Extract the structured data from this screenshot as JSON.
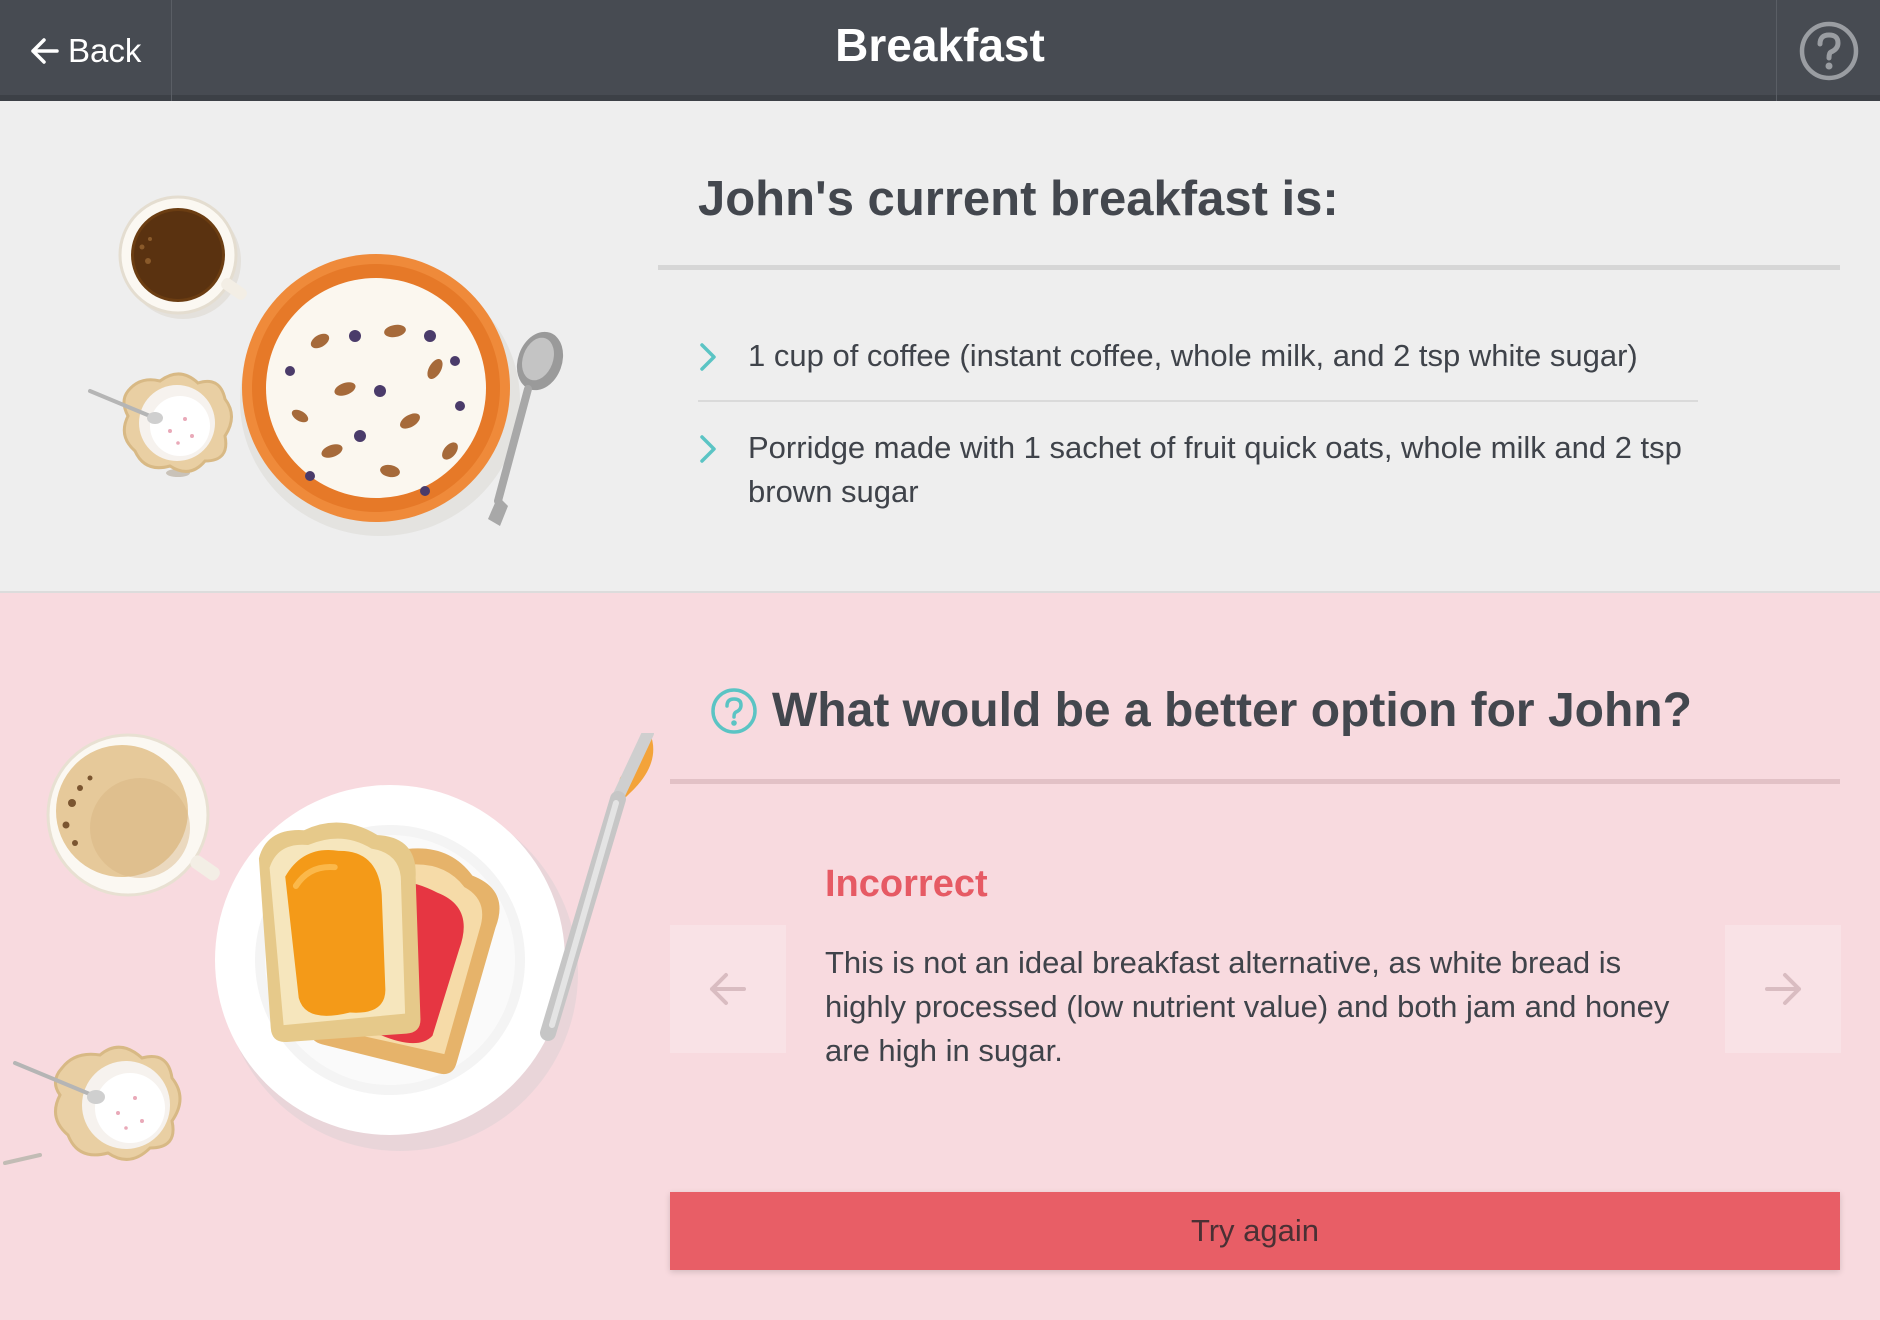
{
  "header": {
    "back_label": "Back",
    "title": "Breakfast"
  },
  "current": {
    "heading": "John's current breakfast is:",
    "items": [
      {
        "text": "1 cup of coffee (instant coffee, whole milk, and 2 tsp white sugar)"
      },
      {
        "text": "Porridge made with 1 sachet of fruit quick oats, whole milk and 2 tsp brown sugar"
      }
    ]
  },
  "question": {
    "heading": "What would be a better option for John?",
    "feedback_title": "Incorrect",
    "feedback_text": "This is not an ideal breakfast alternative, as white bread is highly processed (low nutrient value) and both jam and honey are high in sugar.",
    "try_again_label": "Try again"
  },
  "colors": {
    "header_bg": "#474b52",
    "section_gray": "#eeeeee",
    "section_pink": "#f8dadf",
    "accent_teal": "#5bc4c4",
    "incorrect_red": "#e65a64",
    "button_red": "#e85e66"
  },
  "icons": {
    "back": "arrow-left-icon",
    "help": "help-circle-icon",
    "bullet": "chevron-right-icon",
    "question": "question-circle-icon",
    "prev": "arrow-left-icon",
    "next": "arrow-right-icon"
  }
}
